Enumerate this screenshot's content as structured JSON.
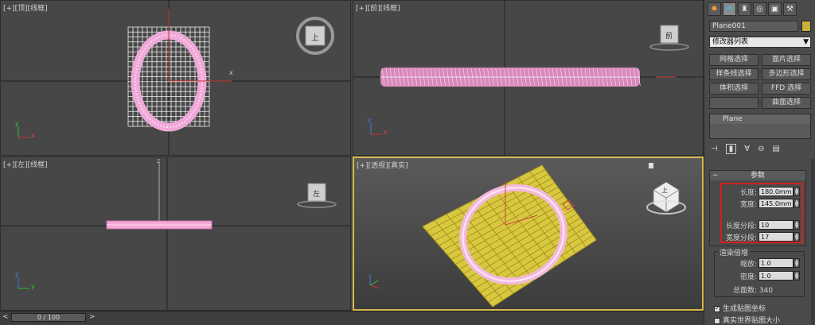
{
  "viewports": {
    "top": {
      "label": "[+][顶][线框]",
      "cube_face": "上"
    },
    "front": {
      "label": "[+][前][线框]",
      "cube_face": "前"
    },
    "left": {
      "label": "[+][左][线框]",
      "cube_face": "左"
    },
    "perspective": {
      "label": "[+][透视][真实]",
      "cube_face": "上"
    }
  },
  "axis_labels": {
    "x": "x",
    "y": "y",
    "z": "z"
  },
  "panel": {
    "object_name": "Plane001",
    "modifier_list": "修改器列表",
    "modifier_buttons": [
      "网格选择",
      "面片选择",
      "样条线选择",
      "多边形选择",
      "体积选择",
      "FFD 选择",
      "曲面选择"
    ],
    "stack_item": "Plane",
    "params_title": "参数",
    "length_label": "长度:",
    "length_value": "180.0mm",
    "width_label": "宽度:",
    "width_value": "145.0mm",
    "length_segs_label": "长度分段:",
    "length_segs_value": "10",
    "width_segs_label": "宽度分段:",
    "width_segs_value": "17",
    "render_title": "渲染倍增",
    "scale_label": "缩放:",
    "scale_value": "1.0",
    "density_label": "密度:",
    "density_value": "1.0",
    "total_faces": "总面数: 340",
    "gen_map_coords": "生成贴图坐标",
    "real_world_map": "真实世界贴图大小"
  },
  "timeline": {
    "frame_text": "0 / 100"
  },
  "colors": {
    "accent_border": "#d8b84a",
    "highlight_box": "#d02020",
    "torus_pink": "#f0a8d8",
    "plane_yellow": "#d8c840",
    "grid_white": "#f4f4f4"
  }
}
